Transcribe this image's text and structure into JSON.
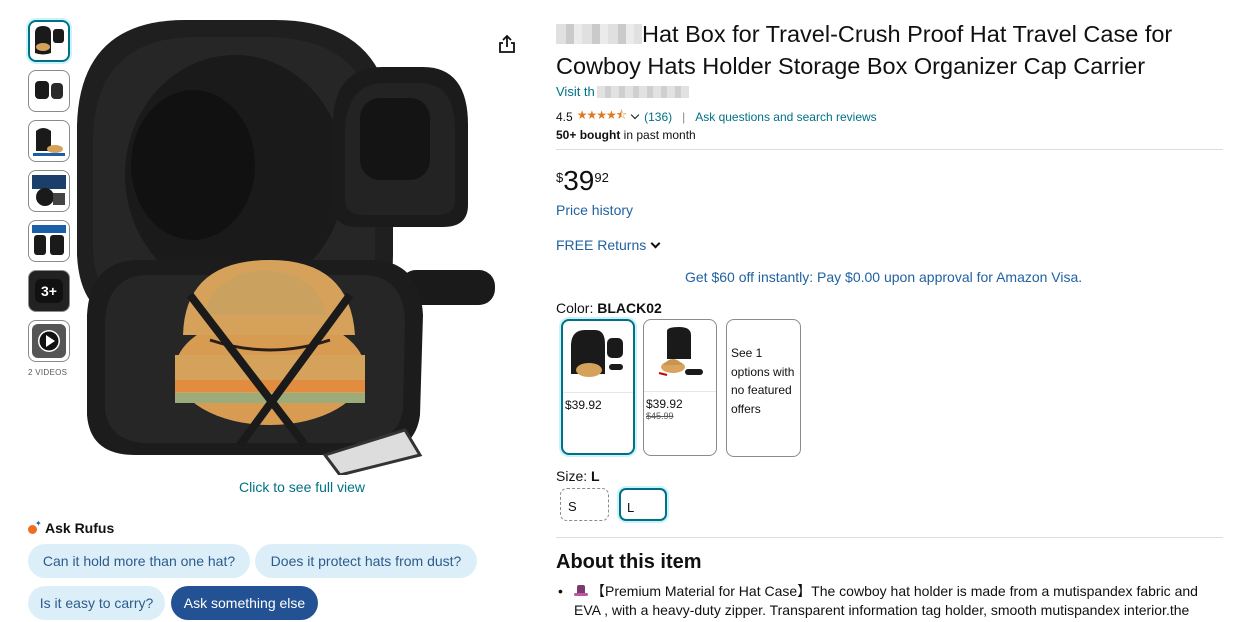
{
  "gallery": {
    "more_label": "3+",
    "videos_label": "2 VIDEOS",
    "click_full_view": "Click to see full view"
  },
  "rufus": {
    "title": "Ask Rufus",
    "chips": [
      "Can it hold more than one hat?",
      "Does it protect hats from dust?",
      "Is it easy to carry?"
    ],
    "ask_button": "Ask something else"
  },
  "product": {
    "title": "Hat Box for Travel-Crush Proof Hat Travel Case for Cowboy Hats Holder Storage Box Organizer Cap Carrier",
    "visit_store": "Visit th",
    "rating_value": "4.5",
    "rating_count": "(136)",
    "ask_link": "Ask questions and search reviews",
    "bought_bold": "50+ bought",
    "bought_rest": " in past month"
  },
  "price": {
    "symbol": "$",
    "whole": "39",
    "fraction": "92",
    "price_history": "Price history",
    "free_returns": "FREE Returns",
    "visa_offer": "Get $60 off instantly: Pay $0.00 upon approval for Amazon Visa."
  },
  "color": {
    "label": "Color: ",
    "selected": "BLACK02",
    "options": [
      {
        "price": "$39.92",
        "old_price": ""
      },
      {
        "price": "$39.92",
        "old_price": "$45.99"
      }
    ],
    "see_options": "See 1 options with no featured offers"
  },
  "size": {
    "label": "Size: ",
    "selected": "L",
    "options": [
      "S",
      "L"
    ]
  },
  "about": {
    "title": "About this item",
    "bullet": "【Premium Material for Hat Case】The cowboy hat holder is made from a mutispandex fabric and EVA , with a heavy-duty zipper. Transparent information tag holder, smooth mutispandex interior.the"
  },
  "colors": {
    "link": "#007185",
    "accent_blue": "#2162a1",
    "star": "#de7921",
    "chip_bg": "#dceff9",
    "chip_primary": "#225294"
  }
}
